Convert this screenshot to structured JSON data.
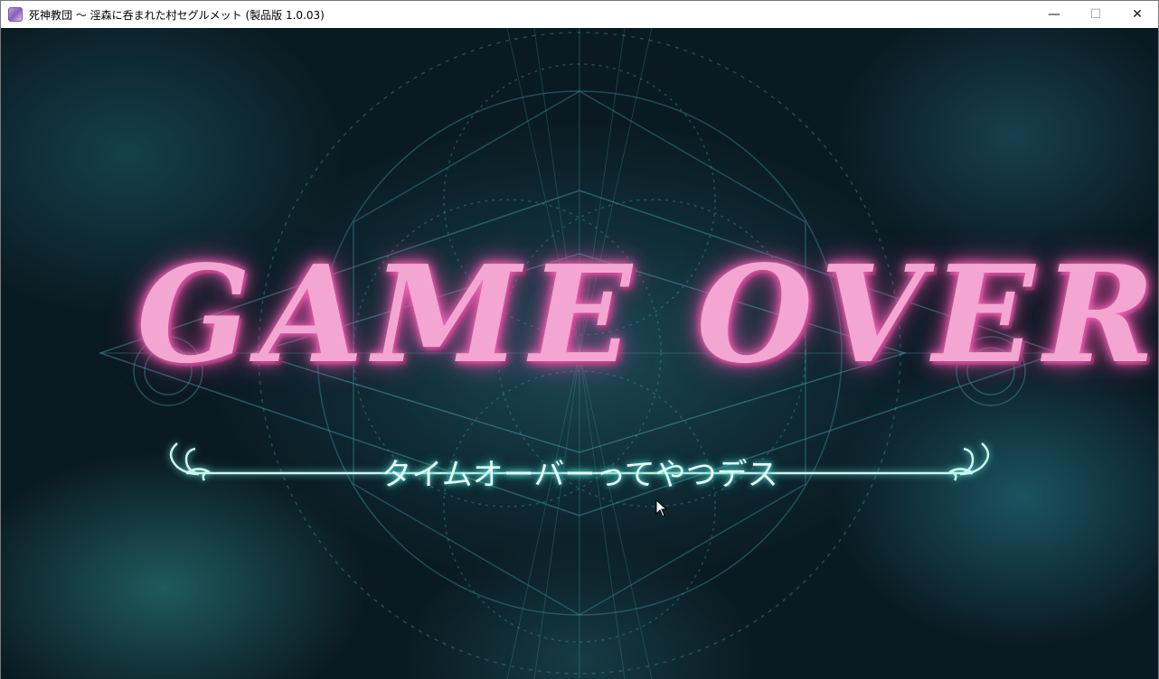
{
  "window": {
    "title": "死神教団 ～ 淫森に呑まれた村セグルメット (製品版 1.0.03)",
    "controls": {
      "minimize": "—",
      "maximize": "☐",
      "close": "✕"
    }
  },
  "game": {
    "headline": "GAME OVER",
    "subtitle": "タイムオーバーってやつデス"
  },
  "colors": {
    "headline": "#f3a6d2",
    "subtitle": "#eafaf8",
    "accent_glow": "#4fe0d6",
    "background": "#0a1a22"
  },
  "icons": [
    "app-icon",
    "minimize-icon",
    "maximize-icon",
    "close-icon",
    "ornament-icon",
    "mouse-cursor-icon"
  ]
}
